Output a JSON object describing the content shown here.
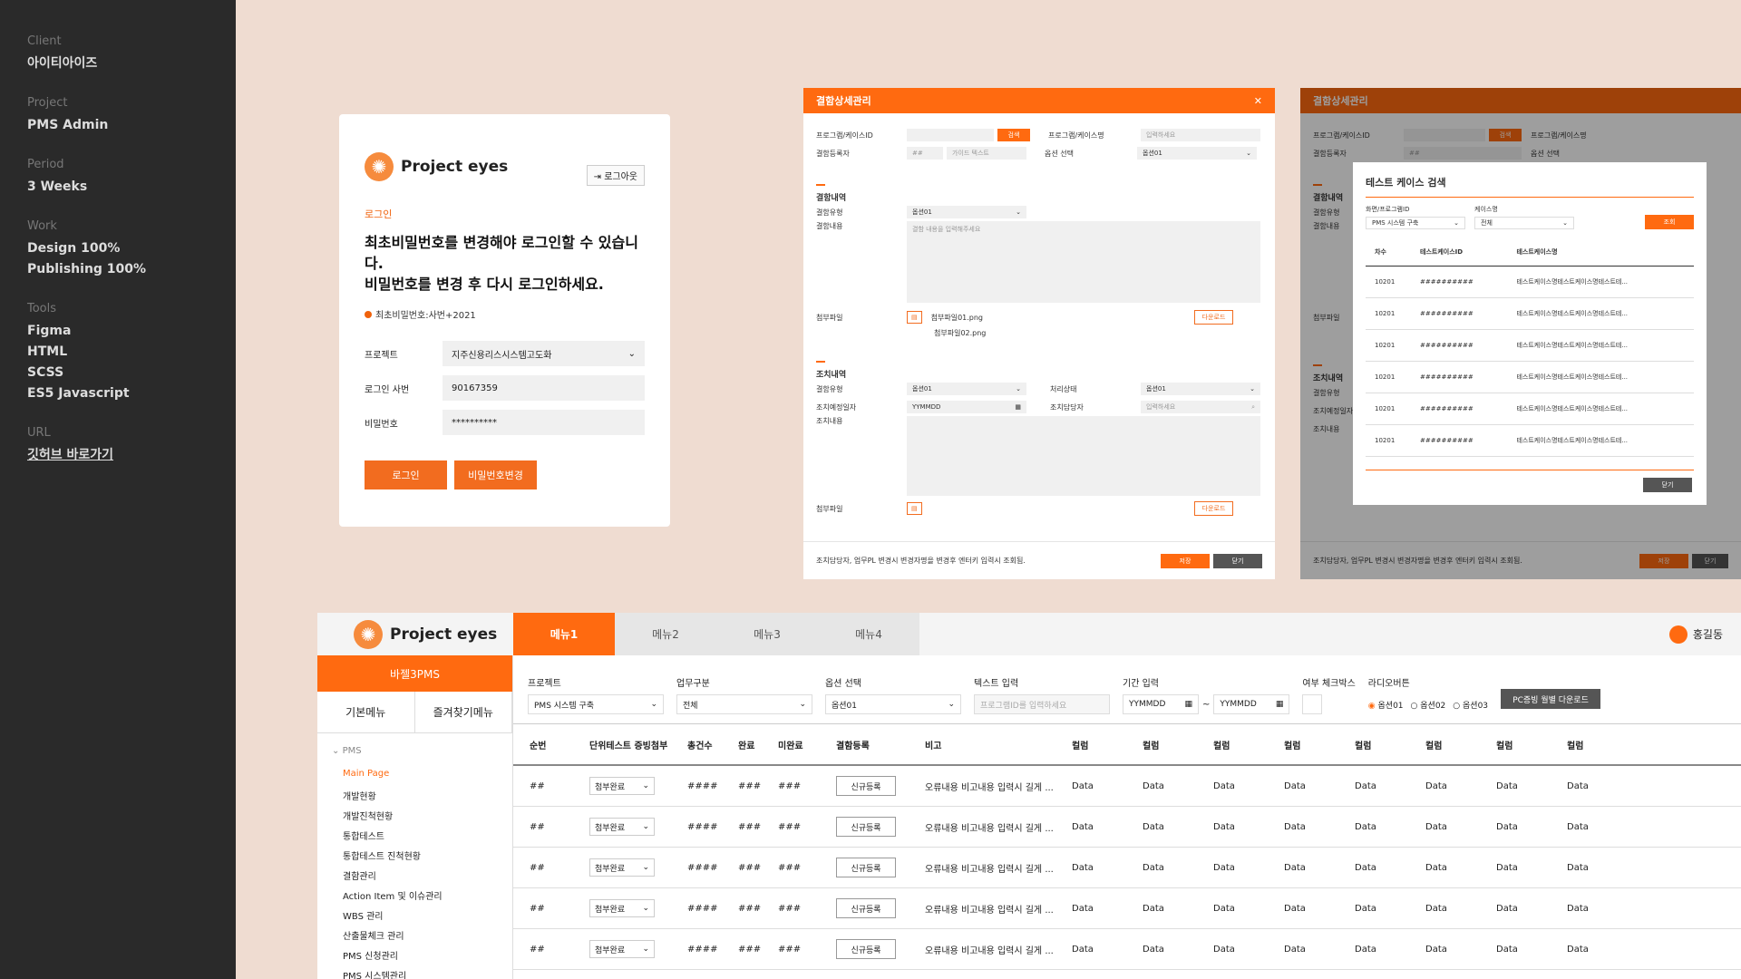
{
  "sidebar": {
    "client_label": "Client",
    "client": "아이티아이즈",
    "project_label": "Project",
    "project": "PMS Admin",
    "period_label": "Period",
    "period": "3 Weeks",
    "work_label": "Work",
    "work": [
      "Design 100%",
      "Publishing 100%"
    ],
    "tools_label": "Tools",
    "tools": [
      "Figma",
      "HTML",
      "SCSS",
      "ES5 Javascript"
    ],
    "url_label": "URL",
    "url": "깃허브 바로가기"
  },
  "login": {
    "logo": "Project eyes",
    "logout": "로그아웃",
    "section": "로그인",
    "heading1": "최초비밀번호를 변경해야 로그인할 수 있습니다.",
    "heading2": "비밀번호를 변경 후 다시 로그인하세요.",
    "note": "최초비밀번호:사번+2021",
    "project_label": "프로젝트",
    "project_value": "지주신용리스시스템고도화",
    "id_label": "로그인 사번",
    "id_value": "90167359",
    "pw_label": "비밀번호",
    "pw_value": "**********",
    "login_btn": "로그인",
    "change_btn": "비밀번호변경"
  },
  "modal": {
    "title": "결함상세관리",
    "f1": "프로그램/케이스ID",
    "search": "검색",
    "f2": "프로그램/케이스명",
    "ph_input": "입력하세요",
    "f3": "결함등록자",
    "hash": "##",
    "guide": "가이드 텍스트",
    "f4": "옵션 선택",
    "opt": "옵션01",
    "sec1": "결함내역",
    "type": "결함유형",
    "content": "결함내용",
    "content_ph": "결함 내용을 입력해주세요",
    "attach": "첨부파일",
    "file1": "첨부파일01.png",
    "file2": "첨부파일02.png",
    "download": "다운로드",
    "sec2": "조치내역",
    "state": "처리상태",
    "date_label": "조치예정일자",
    "date": "YYMMDD",
    "owner": "조치담당자",
    "act": "조치내용",
    "footer": "조치담당자, 업무PL 변경시 변경자명을 변경후 엔터키 입력시 조회됨.",
    "save": "저장",
    "close": "닫기"
  },
  "search_modal": {
    "title": "테스트 케이스 검색",
    "l1": "화면/프로그램ID",
    "v1": "PMS 시스템 구축",
    "l2": "케이스명",
    "v2": "전체",
    "query": "조회",
    "cols": [
      "차수",
      "테스트케이스ID",
      "테스트케이스명"
    ],
    "rows": [
      [
        "10201",
        "##########",
        "테스트케이스명테스트케이스명테스트테..."
      ],
      [
        "10201",
        "##########",
        "테스트케이스명테스트케이스명테스트테..."
      ],
      [
        "10201",
        "##########",
        "테스트케이스명테스트케이스명테스트테..."
      ],
      [
        "10201",
        "##########",
        "테스트케이스명테스트케이스명테스트테..."
      ],
      [
        "10201",
        "##########",
        "테스트케이스명테스트케이스명테스트테..."
      ],
      [
        "10201",
        "##########",
        "테스트케이스명테스트케이스명테스트테..."
      ]
    ],
    "close": "닫기"
  },
  "app": {
    "logo": "Project eyes",
    "tabs": [
      "메뉴1",
      "메뉴2",
      "메뉴3",
      "메뉴4"
    ],
    "user": "홍길동",
    "project": "바젤3PMS",
    "sub": [
      "기본메뉴",
      "즐겨찾기메뉴"
    ],
    "group": "PMS",
    "menu": [
      "Main Page",
      "개발현황",
      "개발진척현황",
      "통합테스트",
      "통합테스트 진척현황",
      "결함관리",
      "Action Item 및 이슈관리",
      "WBS 관리",
      "산출물체크 관리",
      "PMS 신청관리",
      "PMS 시스템관리"
    ],
    "filters": {
      "project": "프로젝트",
      "project_v": "PMS 시스템 구축",
      "biz": "업무구분",
      "biz_v": "전체",
      "opt": "옵션 선택",
      "opt_v": "옵션01",
      "text": "텍스트 입력",
      "text_ph": "프로그램ID를 입력하세요",
      "period": "기간 입력",
      "from": "YYMMDD",
      "to": "YYMMDD",
      "check": "여부 체크박스",
      "radio": "라디오버튼",
      "r1": "옵션01",
      "r2": "옵션02",
      "r3": "옵션03",
      "pcbtn": "PC증빙 월별 다운로드"
    },
    "cols": [
      "순번",
      "단위테스트 증빙첨부",
      "총건수",
      "완료",
      "미완료",
      "결함등록",
      "비고",
      "컬럼",
      "컬럼",
      "컬럼",
      "컬럼",
      "컬럼",
      "컬럼",
      "컬럼",
      "컬럼",
      "컬럼"
    ],
    "row": {
      "no": "##",
      "sel": "첨부완료",
      "total": "####",
      "done": "###",
      "undone": "###",
      "reg": "신규등록",
      "memo": "오류내용 비고내용 입력시 길게 ...",
      "data": "Data"
    }
  },
  "colors": {
    "accent": "#ff6a10",
    "sidebar": "#2a2a2a",
    "bg": "#efdcd1"
  }
}
